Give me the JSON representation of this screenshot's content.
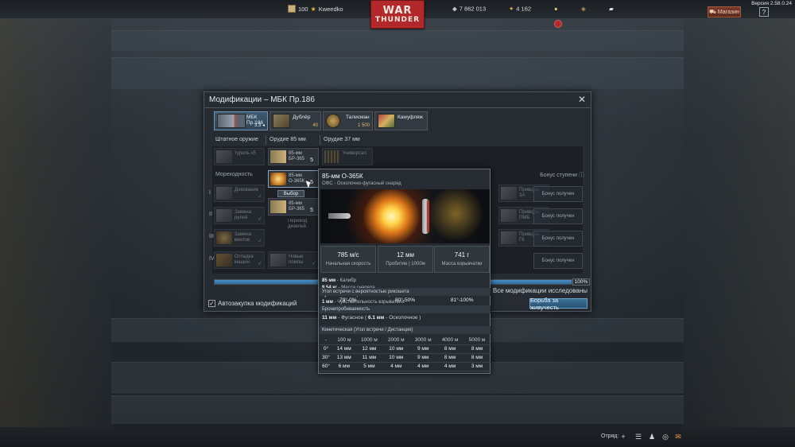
{
  "topbar": {
    "version": "Версия 2.58.0.24",
    "player_level": "100",
    "player_name": "Kweedko",
    "logo_top": "WAR",
    "logo_bottom": "THUNDER",
    "silver_lions": "7 862 013",
    "golden_eagles": "4 162",
    "shop_label": "Магазин",
    "help_label": "?"
  },
  "dialog": {
    "title": "Модификации – МБК Пр.186",
    "close_label": "✕",
    "slots": [
      {
        "label": "МБК Пр.186",
        "sub": "3.3 ◂"
      },
      {
        "label": "Дублёр",
        "sub": "40"
      },
      {
        "label": "Талисман",
        "sub": "1 500"
      },
      {
        "label": "Камуфляж",
        "sub": ""
      }
    ],
    "categories": [
      "Штатное оружие",
      "Орудие 85 мм",
      "Орудие 37 мм"
    ],
    "weapons": {
      "turret": "турель x5",
      "shell1": "85-мм БР-365",
      "shell1_count": "5",
      "shell2": "85-мм О-365К",
      "shell2_count": "5",
      "select_label": "Выбор",
      "shell3": "85-мм БР-365",
      "shell3_count": "5",
      "universal": "Универсал"
    },
    "section_seaworthiness": "Мореходность",
    "section_bonus": "Бонус ступени ⓘ",
    "mods": {
      "mod1": "Докование",
      "mod2": "Замена рулей",
      "mod3": "Замена винтов",
      "mod4": "Отладка машин",
      "mod5": "Новые помпы",
      "mod6": "Перевод дизелей",
      "right1": "Приводы 3А",
      "right2": "Приводы ПМБ",
      "right3": "Приводы ГК"
    },
    "tiers": [
      "I",
      "II",
      "III",
      "IV"
    ],
    "bonus_labels": [
      "Бонус получен",
      "Бонус получен",
      "Бонус получен",
      "Бонус получен"
    ],
    "progress_percent": 100,
    "progress_text": "100%",
    "autobuy_label": "Автозакупка модификаций",
    "all_researched_label": "Все модификации исследованы",
    "fight_button": "Борьба за живучесть"
  },
  "tooltip": {
    "title": "85-мм О-365К",
    "subtitle": "ОФС - Осколочно-фугасный снаряд",
    "stats": [
      {
        "value": "785 м/с",
        "label": "Начальная скорость"
      },
      {
        "value": "12 мм",
        "label": "Пробитие  | 1000м"
      },
      {
        "value": "741 г",
        "label": "Масса взрывчатки"
      }
    ],
    "lines": [
      {
        "bold": "85 мм",
        "text": " - Калибр"
      },
      {
        "bold": "9.54 кг",
        "text": " - Масса снаряда"
      },
      {
        "bold": "Тротил",
        "text": " - Тип взрывчатого вещества"
      },
      {
        "bold": "1 мм",
        "text": " - Чувствительность взрывателя"
      }
    ],
    "ricochet_header": "Угол встречи с вероятностью рикошета",
    "ricochet_values": [
      "79°-0%",
      "80°-50%",
      "81°-100%"
    ],
    "penetration_header": "Бронепробиваемость",
    "penetration_line_bold1": "11 мм",
    "penetration_line_mid": " - Фугасное ( ",
    "penetration_line_bold2": "6.1 мм",
    "penetration_line_end": " - Осколочное )",
    "kinetic_header": "Кинетическая (Угол встречи / Дистанция)",
    "kinetic_columns": [
      "-",
      "100 м",
      "1000 м",
      "2000 м",
      "3000 м",
      "4000 м",
      "5000 м"
    ],
    "kinetic_rows": [
      [
        "0°",
        "14 мм",
        "12 мм",
        "10 мм",
        "9 мм",
        "8 мм",
        "8 мм"
      ],
      [
        "30°",
        "13 мм",
        "11 мм",
        "10 мм",
        "9 мм",
        "8 мм",
        "8 мм"
      ],
      [
        "60°",
        "6 мм",
        "5 мм",
        "4 мм",
        "4 мм",
        "4 мм",
        "3 мм"
      ]
    ]
  },
  "bottombar": {
    "squad_label": "Отряд:"
  }
}
